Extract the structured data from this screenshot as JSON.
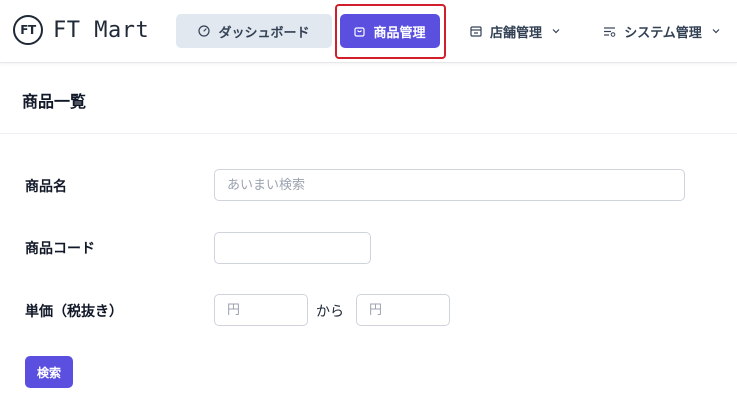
{
  "app": {
    "logo_mark": "FT",
    "name": "FT Mart"
  },
  "nav": {
    "dashboard": "ダッシュボード",
    "product_management": "商品管理",
    "shop_management": "店舗管理",
    "system_management": "システム管理"
  },
  "icons": {
    "dashboard": "gauge-icon",
    "product": "shopping-bag-icon",
    "shop": "store-icon",
    "system": "filter-settings-icon",
    "dropdown": "chevron-down-icon"
  },
  "colors": {
    "primary": "#5b4fe0",
    "highlight": "#d01f2a",
    "dashboard_bg": "#e2e8f0"
  },
  "page": {
    "title": "商品一覧"
  },
  "form": {
    "name_label": "商品名",
    "name_placeholder": "あいまい検索",
    "name_value": "",
    "code_label": "商品コード",
    "code_value": "",
    "price_label": "単価（税抜き）",
    "price_from_placeholder": "円",
    "price_separator": "から",
    "price_to_placeholder": "円",
    "search_button": "検索"
  }
}
